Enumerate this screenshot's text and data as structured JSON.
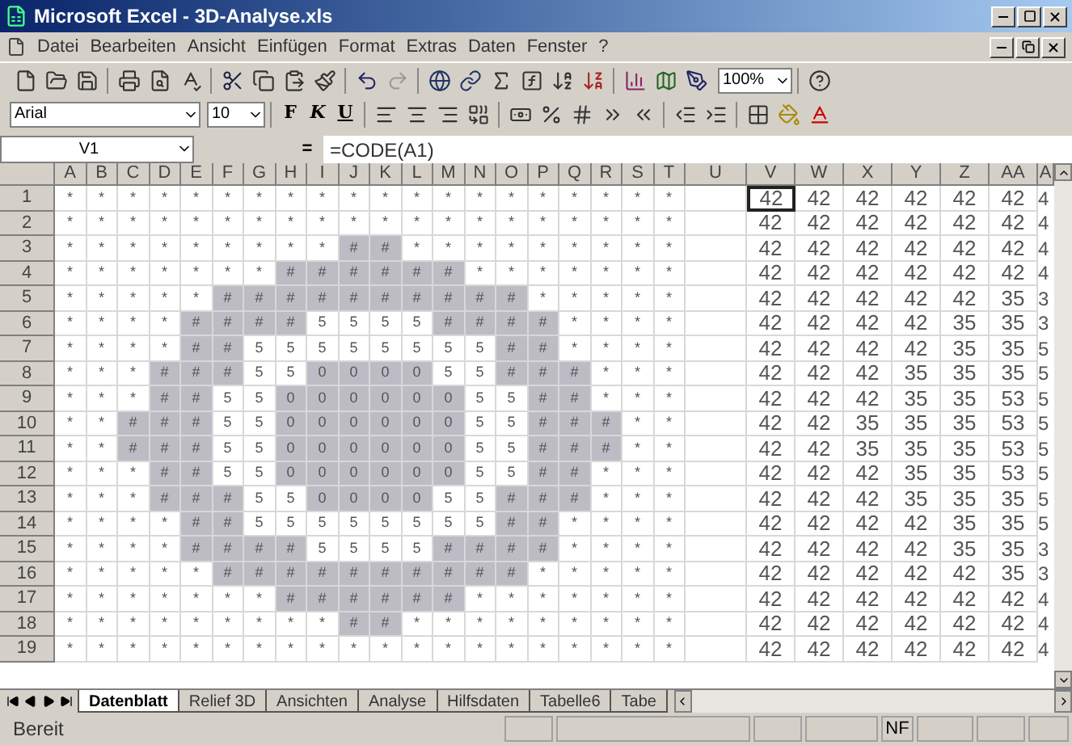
{
  "window": {
    "title": "Microsoft Excel - 3D-Analyse.xls"
  },
  "menu": [
    "Datei",
    "Bearbeiten",
    "Ansicht",
    "Einfügen",
    "Format",
    "Extras",
    "Daten",
    "Fenster",
    "?"
  ],
  "toolbar": {
    "zoom": "100%"
  },
  "formatting": {
    "font": "Arial",
    "size": "10",
    "style_buttons": [
      "F",
      "K",
      "U"
    ]
  },
  "formula_bar": {
    "name_box": "V1",
    "equals": "=",
    "formula": "=CODE(A1)"
  },
  "columns": [
    "A",
    "B",
    "C",
    "D",
    "E",
    "F",
    "G",
    "H",
    "I",
    "J",
    "K",
    "L",
    "M",
    "N",
    "O",
    "P",
    "Q",
    "R",
    "S",
    "T",
    "U",
    "V",
    "W",
    "X",
    "Y",
    "Z",
    "AA",
    "A"
  ],
  "rows": [
    {
      "header": "1",
      "cells": [
        {
          "text": "*",
          "shaded": false
        },
        {
          "text": "*",
          "shaded": false
        },
        {
          "text": "*",
          "shaded": false
        },
        {
          "text": "*",
          "shaded": false
        },
        {
          "text": "*",
          "shaded": false
        },
        {
          "text": "*",
          "shaded": false
        },
        {
          "text": "*",
          "shaded": false
        },
        {
          "text": "*",
          "shaded": false
        },
        {
          "text": "*",
          "shaded": false
        },
        {
          "text": "*",
          "shaded": false
        },
        {
          "text": "*",
          "shaded": false
        },
        {
          "text": "*",
          "shaded": false
        },
        {
          "text": "*",
          "shaded": false
        },
        {
          "text": "*",
          "shaded": false
        },
        {
          "text": "*",
          "shaded": false
        },
        {
          "text": "*",
          "shaded": false
        },
        {
          "text": "*",
          "shaded": false
        },
        {
          "text": "*",
          "shaded": false
        },
        {
          "text": "*",
          "shaded": false
        },
        {
          "text": "*",
          "shaded": false
        }
      ],
      "codes": [
        {
          "text": "42",
          "selected": true
        },
        {
          "text": "42",
          "selected": false
        },
        {
          "text": "42",
          "selected": false
        },
        {
          "text": "42",
          "selected": false
        },
        {
          "text": "42",
          "selected": false
        },
        {
          "text": "42",
          "selected": false
        }
      ],
      "column_ab": "4"
    },
    {
      "header": "2",
      "cells": [
        {
          "text": "*",
          "shaded": false
        },
        {
          "text": "*",
          "shaded": false
        },
        {
          "text": "*",
          "shaded": false
        },
        {
          "text": "*",
          "shaded": false
        },
        {
          "text": "*",
          "shaded": false
        },
        {
          "text": "*",
          "shaded": false
        },
        {
          "text": "*",
          "shaded": false
        },
        {
          "text": "*",
          "shaded": false
        },
        {
          "text": "*",
          "shaded": false
        },
        {
          "text": "*",
          "shaded": false
        },
        {
          "text": "*",
          "shaded": false
        },
        {
          "text": "*",
          "shaded": false
        },
        {
          "text": "*",
          "shaded": false
        },
        {
          "text": "*",
          "shaded": false
        },
        {
          "text": "*",
          "shaded": false
        },
        {
          "text": "*",
          "shaded": false
        },
        {
          "text": "*",
          "shaded": false
        },
        {
          "text": "*",
          "shaded": false
        },
        {
          "text": "*",
          "shaded": false
        },
        {
          "text": "*",
          "shaded": false
        }
      ],
      "codes": [
        {
          "text": "42",
          "selected": false
        },
        {
          "text": "42",
          "selected": false
        },
        {
          "text": "42",
          "selected": false
        },
        {
          "text": "42",
          "selected": false
        },
        {
          "text": "42",
          "selected": false
        },
        {
          "text": "42",
          "selected": false
        }
      ],
      "column_ab": "4"
    },
    {
      "header": "3",
      "cells": [
        {
          "text": "*",
          "shaded": false
        },
        {
          "text": "*",
          "shaded": false
        },
        {
          "text": "*",
          "shaded": false
        },
        {
          "text": "*",
          "shaded": false
        },
        {
          "text": "*",
          "shaded": false
        },
        {
          "text": "*",
          "shaded": false
        },
        {
          "text": "*",
          "shaded": false
        },
        {
          "text": "*",
          "shaded": false
        },
        {
          "text": "*",
          "shaded": false
        },
        {
          "text": "#",
          "shaded": true
        },
        {
          "text": "#",
          "shaded": true
        },
        {
          "text": "*",
          "shaded": false
        },
        {
          "text": "*",
          "shaded": false
        },
        {
          "text": "*",
          "shaded": false
        },
        {
          "text": "*",
          "shaded": false
        },
        {
          "text": "*",
          "shaded": false
        },
        {
          "text": "*",
          "shaded": false
        },
        {
          "text": "*",
          "shaded": false
        },
        {
          "text": "*",
          "shaded": false
        },
        {
          "text": "*",
          "shaded": false
        }
      ],
      "codes": [
        {
          "text": "42",
          "selected": false
        },
        {
          "text": "42",
          "selected": false
        },
        {
          "text": "42",
          "selected": false
        },
        {
          "text": "42",
          "selected": false
        },
        {
          "text": "42",
          "selected": false
        },
        {
          "text": "42",
          "selected": false
        }
      ],
      "column_ab": "4"
    },
    {
      "header": "4",
      "cells": [
        {
          "text": "*",
          "shaded": false
        },
        {
          "text": "*",
          "shaded": false
        },
        {
          "text": "*",
          "shaded": false
        },
        {
          "text": "*",
          "shaded": false
        },
        {
          "text": "*",
          "shaded": false
        },
        {
          "text": "*",
          "shaded": false
        },
        {
          "text": "*",
          "shaded": false
        },
        {
          "text": "#",
          "shaded": true
        },
        {
          "text": "#",
          "shaded": true
        },
        {
          "text": "#",
          "shaded": true
        },
        {
          "text": "#",
          "shaded": true
        },
        {
          "text": "#",
          "shaded": true
        },
        {
          "text": "#",
          "shaded": true
        },
        {
          "text": "*",
          "shaded": false
        },
        {
          "text": "*",
          "shaded": false
        },
        {
          "text": "*",
          "shaded": false
        },
        {
          "text": "*",
          "shaded": false
        },
        {
          "text": "*",
          "shaded": false
        },
        {
          "text": "*",
          "shaded": false
        },
        {
          "text": "*",
          "shaded": false
        }
      ],
      "codes": [
        {
          "text": "42",
          "selected": false
        },
        {
          "text": "42",
          "selected": false
        },
        {
          "text": "42",
          "selected": false
        },
        {
          "text": "42",
          "selected": false
        },
        {
          "text": "42",
          "selected": false
        },
        {
          "text": "42",
          "selected": false
        }
      ],
      "column_ab": "4"
    },
    {
      "header": "5",
      "cells": [
        {
          "text": "*",
          "shaded": false
        },
        {
          "text": "*",
          "shaded": false
        },
        {
          "text": "*",
          "shaded": false
        },
        {
          "text": "*",
          "shaded": false
        },
        {
          "text": "*",
          "shaded": false
        },
        {
          "text": "#",
          "shaded": true
        },
        {
          "text": "#",
          "shaded": true
        },
        {
          "text": "#",
          "shaded": true
        },
        {
          "text": "#",
          "shaded": true
        },
        {
          "text": "#",
          "shaded": true
        },
        {
          "text": "#",
          "shaded": true
        },
        {
          "text": "#",
          "shaded": true
        },
        {
          "text": "#",
          "shaded": true
        },
        {
          "text": "#",
          "shaded": true
        },
        {
          "text": "#",
          "shaded": true
        },
        {
          "text": "*",
          "shaded": false
        },
        {
          "text": "*",
          "shaded": false
        },
        {
          "text": "*",
          "shaded": false
        },
        {
          "text": "*",
          "shaded": false
        },
        {
          "text": "*",
          "shaded": false
        }
      ],
      "codes": [
        {
          "text": "42",
          "selected": false
        },
        {
          "text": "42",
          "selected": false
        },
        {
          "text": "42",
          "selected": false
        },
        {
          "text": "42",
          "selected": false
        },
        {
          "text": "42",
          "selected": false
        },
        {
          "text": "35",
          "selected": false
        }
      ],
      "column_ab": "3"
    },
    {
      "header": "6",
      "cells": [
        {
          "text": "*",
          "shaded": false
        },
        {
          "text": "*",
          "shaded": false
        },
        {
          "text": "*",
          "shaded": false
        },
        {
          "text": "*",
          "shaded": false
        },
        {
          "text": "#",
          "shaded": true
        },
        {
          "text": "#",
          "shaded": true
        },
        {
          "text": "#",
          "shaded": true
        },
        {
          "text": "#",
          "shaded": true
        },
        {
          "text": "5",
          "shaded": false
        },
        {
          "text": "5",
          "shaded": false
        },
        {
          "text": "5",
          "shaded": false
        },
        {
          "text": "5",
          "shaded": false
        },
        {
          "text": "#",
          "shaded": true
        },
        {
          "text": "#",
          "shaded": true
        },
        {
          "text": "#",
          "shaded": true
        },
        {
          "text": "#",
          "shaded": true
        },
        {
          "text": "*",
          "shaded": false
        },
        {
          "text": "*",
          "shaded": false
        },
        {
          "text": "*",
          "shaded": false
        },
        {
          "text": "*",
          "shaded": false
        }
      ],
      "codes": [
        {
          "text": "42",
          "selected": false
        },
        {
          "text": "42",
          "selected": false
        },
        {
          "text": "42",
          "selected": false
        },
        {
          "text": "42",
          "selected": false
        },
        {
          "text": "35",
          "selected": false
        },
        {
          "text": "35",
          "selected": false
        }
      ],
      "column_ab": "3"
    },
    {
      "header": "7",
      "cells": [
        {
          "text": "*",
          "shaded": false
        },
        {
          "text": "*",
          "shaded": false
        },
        {
          "text": "*",
          "shaded": false
        },
        {
          "text": "*",
          "shaded": false
        },
        {
          "text": "#",
          "shaded": true
        },
        {
          "text": "#",
          "shaded": true
        },
        {
          "text": "5",
          "shaded": false
        },
        {
          "text": "5",
          "shaded": false
        },
        {
          "text": "5",
          "shaded": false
        },
        {
          "text": "5",
          "shaded": false
        },
        {
          "text": "5",
          "shaded": false
        },
        {
          "text": "5",
          "shaded": false
        },
        {
          "text": "5",
          "shaded": false
        },
        {
          "text": "5",
          "shaded": false
        },
        {
          "text": "#",
          "shaded": true
        },
        {
          "text": "#",
          "shaded": true
        },
        {
          "text": "*",
          "shaded": false
        },
        {
          "text": "*",
          "shaded": false
        },
        {
          "text": "*",
          "shaded": false
        },
        {
          "text": "*",
          "shaded": false
        }
      ],
      "codes": [
        {
          "text": "42",
          "selected": false
        },
        {
          "text": "42",
          "selected": false
        },
        {
          "text": "42",
          "selected": false
        },
        {
          "text": "42",
          "selected": false
        },
        {
          "text": "35",
          "selected": false
        },
        {
          "text": "35",
          "selected": false
        }
      ],
      "column_ab": "5"
    },
    {
      "header": "8",
      "cells": [
        {
          "text": "*",
          "shaded": false
        },
        {
          "text": "*",
          "shaded": false
        },
        {
          "text": "*",
          "shaded": false
        },
        {
          "text": "#",
          "shaded": true
        },
        {
          "text": "#",
          "shaded": true
        },
        {
          "text": "#",
          "shaded": true
        },
        {
          "text": "5",
          "shaded": false
        },
        {
          "text": "5",
          "shaded": false
        },
        {
          "text": "0",
          "shaded": true
        },
        {
          "text": "0",
          "shaded": true
        },
        {
          "text": "0",
          "shaded": true
        },
        {
          "text": "0",
          "shaded": true
        },
        {
          "text": "5",
          "shaded": false
        },
        {
          "text": "5",
          "shaded": false
        },
        {
          "text": "#",
          "shaded": true
        },
        {
          "text": "#",
          "shaded": true
        },
        {
          "text": "#",
          "shaded": true
        },
        {
          "text": "*",
          "shaded": false
        },
        {
          "text": "*",
          "shaded": false
        },
        {
          "text": "*",
          "shaded": false
        }
      ],
      "codes": [
        {
          "text": "42",
          "selected": false
        },
        {
          "text": "42",
          "selected": false
        },
        {
          "text": "42",
          "selected": false
        },
        {
          "text": "35",
          "selected": false
        },
        {
          "text": "35",
          "selected": false
        },
        {
          "text": "35",
          "selected": false
        }
      ],
      "column_ab": "5"
    },
    {
      "header": "9",
      "cells": [
        {
          "text": "*",
          "shaded": false
        },
        {
          "text": "*",
          "shaded": false
        },
        {
          "text": "*",
          "shaded": false
        },
        {
          "text": "#",
          "shaded": true
        },
        {
          "text": "#",
          "shaded": true
        },
        {
          "text": "5",
          "shaded": false
        },
        {
          "text": "5",
          "shaded": false
        },
        {
          "text": "0",
          "shaded": true
        },
        {
          "text": "0",
          "shaded": true
        },
        {
          "text": "0",
          "shaded": true
        },
        {
          "text": "0",
          "shaded": true
        },
        {
          "text": "0",
          "shaded": true
        },
        {
          "text": "0",
          "shaded": true
        },
        {
          "text": "5",
          "shaded": false
        },
        {
          "text": "5",
          "shaded": false
        },
        {
          "text": "#",
          "shaded": true
        },
        {
          "text": "#",
          "shaded": true
        },
        {
          "text": "*",
          "shaded": false
        },
        {
          "text": "*",
          "shaded": false
        },
        {
          "text": "*",
          "shaded": false
        }
      ],
      "codes": [
        {
          "text": "42",
          "selected": false
        },
        {
          "text": "42",
          "selected": false
        },
        {
          "text": "42",
          "selected": false
        },
        {
          "text": "35",
          "selected": false
        },
        {
          "text": "35",
          "selected": false
        },
        {
          "text": "53",
          "selected": false
        }
      ],
      "column_ab": "5"
    },
    {
      "header": "10",
      "cells": [
        {
          "text": "*",
          "shaded": false
        },
        {
          "text": "*",
          "shaded": false
        },
        {
          "text": "#",
          "shaded": true
        },
        {
          "text": "#",
          "shaded": true
        },
        {
          "text": "#",
          "shaded": true
        },
        {
          "text": "5",
          "shaded": false
        },
        {
          "text": "5",
          "shaded": false
        },
        {
          "text": "0",
          "shaded": true
        },
        {
          "text": "0",
          "shaded": true
        },
        {
          "text": "0",
          "shaded": true
        },
        {
          "text": "0",
          "shaded": true
        },
        {
          "text": "0",
          "shaded": true
        },
        {
          "text": "0",
          "shaded": true
        },
        {
          "text": "5",
          "shaded": false
        },
        {
          "text": "5",
          "shaded": false
        },
        {
          "text": "#",
          "shaded": true
        },
        {
          "text": "#",
          "shaded": true
        },
        {
          "text": "#",
          "shaded": true
        },
        {
          "text": "*",
          "shaded": false
        },
        {
          "text": "*",
          "shaded": false
        }
      ],
      "codes": [
        {
          "text": "42",
          "selected": false
        },
        {
          "text": "42",
          "selected": false
        },
        {
          "text": "35",
          "selected": false
        },
        {
          "text": "35",
          "selected": false
        },
        {
          "text": "35",
          "selected": false
        },
        {
          "text": "53",
          "selected": false
        }
      ],
      "column_ab": "5"
    },
    {
      "header": "11",
      "cells": [
        {
          "text": "*",
          "shaded": false
        },
        {
          "text": "*",
          "shaded": false
        },
        {
          "text": "#",
          "shaded": true
        },
        {
          "text": "#",
          "shaded": true
        },
        {
          "text": "#",
          "shaded": true
        },
        {
          "text": "5",
          "shaded": false
        },
        {
          "text": "5",
          "shaded": false
        },
        {
          "text": "0",
          "shaded": true
        },
        {
          "text": "0",
          "shaded": true
        },
        {
          "text": "0",
          "shaded": true
        },
        {
          "text": "0",
          "shaded": true
        },
        {
          "text": "0",
          "shaded": true
        },
        {
          "text": "0",
          "shaded": true
        },
        {
          "text": "5",
          "shaded": false
        },
        {
          "text": "5",
          "shaded": false
        },
        {
          "text": "#",
          "shaded": true
        },
        {
          "text": "#",
          "shaded": true
        },
        {
          "text": "#",
          "shaded": true
        },
        {
          "text": "*",
          "shaded": false
        },
        {
          "text": "*",
          "shaded": false
        }
      ],
      "codes": [
        {
          "text": "42",
          "selected": false
        },
        {
          "text": "42",
          "selected": false
        },
        {
          "text": "35",
          "selected": false
        },
        {
          "text": "35",
          "selected": false
        },
        {
          "text": "35",
          "selected": false
        },
        {
          "text": "53",
          "selected": false
        }
      ],
      "column_ab": "5"
    },
    {
      "header": "12",
      "cells": [
        {
          "text": "*",
          "shaded": false
        },
        {
          "text": "*",
          "shaded": false
        },
        {
          "text": "*",
          "shaded": false
        },
        {
          "text": "#",
          "shaded": true
        },
        {
          "text": "#",
          "shaded": true
        },
        {
          "text": "5",
          "shaded": false
        },
        {
          "text": "5",
          "shaded": false
        },
        {
          "text": "0",
          "shaded": true
        },
        {
          "text": "0",
          "shaded": true
        },
        {
          "text": "0",
          "shaded": true
        },
        {
          "text": "0",
          "shaded": true
        },
        {
          "text": "0",
          "shaded": true
        },
        {
          "text": "0",
          "shaded": true
        },
        {
          "text": "5",
          "shaded": false
        },
        {
          "text": "5",
          "shaded": false
        },
        {
          "text": "#",
          "shaded": true
        },
        {
          "text": "#",
          "shaded": true
        },
        {
          "text": "*",
          "shaded": false
        },
        {
          "text": "*",
          "shaded": false
        },
        {
          "text": "*",
          "shaded": false
        }
      ],
      "codes": [
        {
          "text": "42",
          "selected": false
        },
        {
          "text": "42",
          "selected": false
        },
        {
          "text": "42",
          "selected": false
        },
        {
          "text": "35",
          "selected": false
        },
        {
          "text": "35",
          "selected": false
        },
        {
          "text": "53",
          "selected": false
        }
      ],
      "column_ab": "5"
    },
    {
      "header": "13",
      "cells": [
        {
          "text": "*",
          "shaded": false
        },
        {
          "text": "*",
          "shaded": false
        },
        {
          "text": "*",
          "shaded": false
        },
        {
          "text": "#",
          "shaded": true
        },
        {
          "text": "#",
          "shaded": true
        },
        {
          "text": "#",
          "shaded": true
        },
        {
          "text": "5",
          "shaded": false
        },
        {
          "text": "5",
          "shaded": false
        },
        {
          "text": "0",
          "shaded": true
        },
        {
          "text": "0",
          "shaded": true
        },
        {
          "text": "0",
          "shaded": true
        },
        {
          "text": "0",
          "shaded": true
        },
        {
          "text": "5",
          "shaded": false
        },
        {
          "text": "5",
          "shaded": false
        },
        {
          "text": "#",
          "shaded": true
        },
        {
          "text": "#",
          "shaded": true
        },
        {
          "text": "#",
          "shaded": true
        },
        {
          "text": "*",
          "shaded": false
        },
        {
          "text": "*",
          "shaded": false
        },
        {
          "text": "*",
          "shaded": false
        }
      ],
      "codes": [
        {
          "text": "42",
          "selected": false
        },
        {
          "text": "42",
          "selected": false
        },
        {
          "text": "42",
          "selected": false
        },
        {
          "text": "35",
          "selected": false
        },
        {
          "text": "35",
          "selected": false
        },
        {
          "text": "35",
          "selected": false
        }
      ],
      "column_ab": "5"
    },
    {
      "header": "14",
      "cells": [
        {
          "text": "*",
          "shaded": false
        },
        {
          "text": "*",
          "shaded": false
        },
        {
          "text": "*",
          "shaded": false
        },
        {
          "text": "*",
          "shaded": false
        },
        {
          "text": "#",
          "shaded": true
        },
        {
          "text": "#",
          "shaded": true
        },
        {
          "text": "5",
          "shaded": false
        },
        {
          "text": "5",
          "shaded": false
        },
        {
          "text": "5",
          "shaded": false
        },
        {
          "text": "5",
          "shaded": false
        },
        {
          "text": "5",
          "shaded": false
        },
        {
          "text": "5",
          "shaded": false
        },
        {
          "text": "5",
          "shaded": false
        },
        {
          "text": "5",
          "shaded": false
        },
        {
          "text": "#",
          "shaded": true
        },
        {
          "text": "#",
          "shaded": true
        },
        {
          "text": "*",
          "shaded": false
        },
        {
          "text": "*",
          "shaded": false
        },
        {
          "text": "*",
          "shaded": false
        },
        {
          "text": "*",
          "shaded": false
        }
      ],
      "codes": [
        {
          "text": "42",
          "selected": false
        },
        {
          "text": "42",
          "selected": false
        },
        {
          "text": "42",
          "selected": false
        },
        {
          "text": "42",
          "selected": false
        },
        {
          "text": "35",
          "selected": false
        },
        {
          "text": "35",
          "selected": false
        }
      ],
      "column_ab": "5"
    },
    {
      "header": "15",
      "cells": [
        {
          "text": "*",
          "shaded": false
        },
        {
          "text": "*",
          "shaded": false
        },
        {
          "text": "*",
          "shaded": false
        },
        {
          "text": "*",
          "shaded": false
        },
        {
          "text": "#",
          "shaded": true
        },
        {
          "text": "#",
          "shaded": true
        },
        {
          "text": "#",
          "shaded": true
        },
        {
          "text": "#",
          "shaded": true
        },
        {
          "text": "5",
          "shaded": false
        },
        {
          "text": "5",
          "shaded": false
        },
        {
          "text": "5",
          "shaded": false
        },
        {
          "text": "5",
          "shaded": false
        },
        {
          "text": "#",
          "shaded": true
        },
        {
          "text": "#",
          "shaded": true
        },
        {
          "text": "#",
          "shaded": true
        },
        {
          "text": "#",
          "shaded": true
        },
        {
          "text": "*",
          "shaded": false
        },
        {
          "text": "*",
          "shaded": false
        },
        {
          "text": "*",
          "shaded": false
        },
        {
          "text": "*",
          "shaded": false
        }
      ],
      "codes": [
        {
          "text": "42",
          "selected": false
        },
        {
          "text": "42",
          "selected": false
        },
        {
          "text": "42",
          "selected": false
        },
        {
          "text": "42",
          "selected": false
        },
        {
          "text": "35",
          "selected": false
        },
        {
          "text": "35",
          "selected": false
        }
      ],
      "column_ab": "3"
    },
    {
      "header": "16",
      "cells": [
        {
          "text": "*",
          "shaded": false
        },
        {
          "text": "*",
          "shaded": false
        },
        {
          "text": "*",
          "shaded": false
        },
        {
          "text": "*",
          "shaded": false
        },
        {
          "text": "*",
          "shaded": false
        },
        {
          "text": "#",
          "shaded": true
        },
        {
          "text": "#",
          "shaded": true
        },
        {
          "text": "#",
          "shaded": true
        },
        {
          "text": "#",
          "shaded": true
        },
        {
          "text": "#",
          "shaded": true
        },
        {
          "text": "#",
          "shaded": true
        },
        {
          "text": "#",
          "shaded": true
        },
        {
          "text": "#",
          "shaded": true
        },
        {
          "text": "#",
          "shaded": true
        },
        {
          "text": "#",
          "shaded": true
        },
        {
          "text": "*",
          "shaded": false
        },
        {
          "text": "*",
          "shaded": false
        },
        {
          "text": "*",
          "shaded": false
        },
        {
          "text": "*",
          "shaded": false
        },
        {
          "text": "*",
          "shaded": false
        }
      ],
      "codes": [
        {
          "text": "42",
          "selected": false
        },
        {
          "text": "42",
          "selected": false
        },
        {
          "text": "42",
          "selected": false
        },
        {
          "text": "42",
          "selected": false
        },
        {
          "text": "42",
          "selected": false
        },
        {
          "text": "35",
          "selected": false
        }
      ],
      "column_ab": "3"
    },
    {
      "header": "17",
      "cells": [
        {
          "text": "*",
          "shaded": false
        },
        {
          "text": "*",
          "shaded": false
        },
        {
          "text": "*",
          "shaded": false
        },
        {
          "text": "*",
          "shaded": false
        },
        {
          "text": "*",
          "shaded": false
        },
        {
          "text": "*",
          "shaded": false
        },
        {
          "text": "*",
          "shaded": false
        },
        {
          "text": "#",
          "shaded": true
        },
        {
          "text": "#",
          "shaded": true
        },
        {
          "text": "#",
          "shaded": true
        },
        {
          "text": "#",
          "shaded": true
        },
        {
          "text": "#",
          "shaded": true
        },
        {
          "text": "#",
          "shaded": true
        },
        {
          "text": "*",
          "shaded": false
        },
        {
          "text": "*",
          "shaded": false
        },
        {
          "text": "*",
          "shaded": false
        },
        {
          "text": "*",
          "shaded": false
        },
        {
          "text": "*",
          "shaded": false
        },
        {
          "text": "*",
          "shaded": false
        },
        {
          "text": "*",
          "shaded": false
        }
      ],
      "codes": [
        {
          "text": "42",
          "selected": false
        },
        {
          "text": "42",
          "selected": false
        },
        {
          "text": "42",
          "selected": false
        },
        {
          "text": "42",
          "selected": false
        },
        {
          "text": "42",
          "selected": false
        },
        {
          "text": "42",
          "selected": false
        }
      ],
      "column_ab": "4"
    },
    {
      "header": "18",
      "cells": [
        {
          "text": "*",
          "shaded": false
        },
        {
          "text": "*",
          "shaded": false
        },
        {
          "text": "*",
          "shaded": false
        },
        {
          "text": "*",
          "shaded": false
        },
        {
          "text": "*",
          "shaded": false
        },
        {
          "text": "*",
          "shaded": false
        },
        {
          "text": "*",
          "shaded": false
        },
        {
          "text": "*",
          "shaded": false
        },
        {
          "text": "*",
          "shaded": false
        },
        {
          "text": "#",
          "shaded": true
        },
        {
          "text": "#",
          "shaded": true
        },
        {
          "text": "*",
          "shaded": false
        },
        {
          "text": "*",
          "shaded": false
        },
        {
          "text": "*",
          "shaded": false
        },
        {
          "text": "*",
          "shaded": false
        },
        {
          "text": "*",
          "shaded": false
        },
        {
          "text": "*",
          "shaded": false
        },
        {
          "text": "*",
          "shaded": false
        },
        {
          "text": "*",
          "shaded": false
        },
        {
          "text": "*",
          "shaded": false
        }
      ],
      "codes": [
        {
          "text": "42",
          "selected": false
        },
        {
          "text": "42",
          "selected": false
        },
        {
          "text": "42",
          "selected": false
        },
        {
          "text": "42",
          "selected": false
        },
        {
          "text": "42",
          "selected": false
        },
        {
          "text": "42",
          "selected": false
        }
      ],
      "column_ab": "4"
    },
    {
      "header": "19",
      "cells": [
        {
          "text": "*",
          "shaded": false
        },
        {
          "text": "*",
          "shaded": false
        },
        {
          "text": "*",
          "shaded": false
        },
        {
          "text": "*",
          "shaded": false
        },
        {
          "text": "*",
          "shaded": false
        },
        {
          "text": "*",
          "shaded": false
        },
        {
          "text": "*",
          "shaded": false
        },
        {
          "text": "*",
          "shaded": false
        },
        {
          "text": "*",
          "shaded": false
        },
        {
          "text": "*",
          "shaded": false
        },
        {
          "text": "*",
          "shaded": false
        },
        {
          "text": "*",
          "shaded": false
        },
        {
          "text": "*",
          "shaded": false
        },
        {
          "text": "*",
          "shaded": false
        },
        {
          "text": "*",
          "shaded": false
        },
        {
          "text": "*",
          "shaded": false
        },
        {
          "text": "*",
          "shaded": false
        },
        {
          "text": "*",
          "shaded": false
        },
        {
          "text": "*",
          "shaded": false
        },
        {
          "text": "*",
          "shaded": false
        }
      ],
      "codes": [
        {
          "text": "42",
          "selected": false
        },
        {
          "text": "42",
          "selected": false
        },
        {
          "text": "42",
          "selected": false
        },
        {
          "text": "42",
          "selected": false
        },
        {
          "text": "42",
          "selected": false
        },
        {
          "text": "42",
          "selected": false
        }
      ],
      "column_ab": "4"
    }
  ],
  "sheet_tabs": [
    {
      "label": "Datenblatt",
      "selected": true
    },
    {
      "label": "Relief 3D",
      "selected": false
    },
    {
      "label": "Ansichten",
      "selected": false
    },
    {
      "label": "Analyse",
      "selected": false
    },
    {
      "label": "Hilfsdaten",
      "selected": false
    },
    {
      "label": "Tabelle6",
      "selected": false
    },
    {
      "label": "Tabe",
      "selected": false
    }
  ],
  "status_bar": {
    "text": "Bereit",
    "indicator": "NF"
  }
}
